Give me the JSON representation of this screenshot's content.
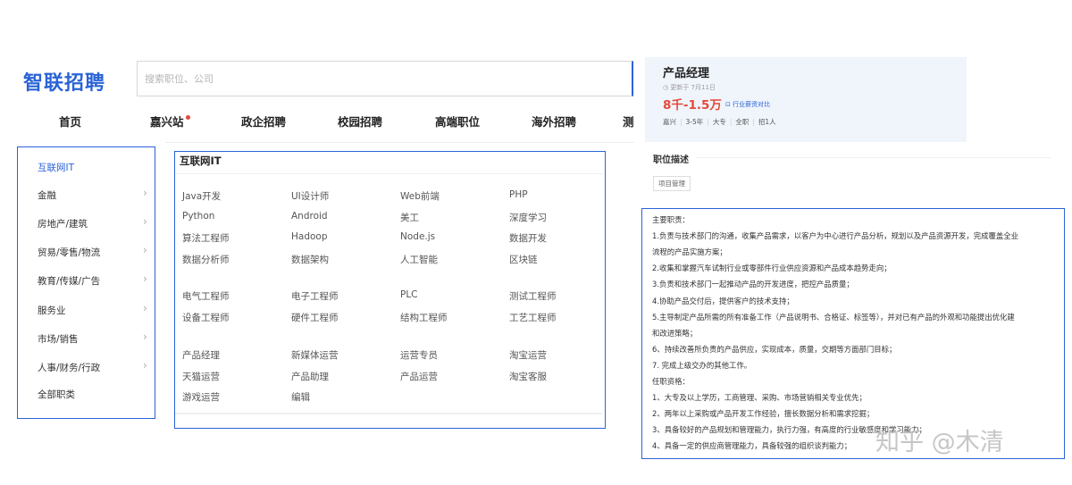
{
  "header": {
    "logo": "智联招聘",
    "search_placeholder": "搜索职位、公司"
  },
  "nav": [
    "首页",
    "嘉兴站",
    "政企招聘",
    "校园招聘",
    "高端职位",
    "海外招聘",
    "测"
  ],
  "categories": [
    {
      "label": "互联网IT",
      "chevron": ""
    },
    {
      "label": "金融",
      "chevron": "›"
    },
    {
      "label": "房地产/建筑",
      "chevron": "›"
    },
    {
      "label": "贸易/零售/物流",
      "chevron": "›"
    },
    {
      "label": "教育/传媒/广告",
      "chevron": "›"
    },
    {
      "label": "服务业",
      "chevron": "›"
    },
    {
      "label": "市场/销售",
      "chevron": "›"
    },
    {
      "label": "人事/财务/行政",
      "chevron": "›"
    },
    {
      "label": "全部职类",
      "chevron": ""
    }
  ],
  "jobs": {
    "title": "互联网IT",
    "groups": [
      [
        [
          "Java开发",
          "UI设计师",
          "Web前端",
          "PHP"
        ],
        [
          "Python",
          "Android",
          "美工",
          "深度学习"
        ],
        [
          "算法工程师",
          "Hadoop",
          "Node.js",
          "数据开发"
        ],
        [
          "数据分析师",
          "数据架构",
          "人工智能",
          "区块链"
        ]
      ],
      [
        [
          "电气工程师",
          "电子工程师",
          "PLC",
          "测试工程师"
        ],
        [
          "设备工程师",
          "硬件工程师",
          "结构工程师",
          "工艺工程师"
        ]
      ],
      [
        [
          "产品经理",
          "新媒体运营",
          "运营专员",
          "淘宝运营"
        ],
        [
          "天猫运营",
          "产品助理",
          "产品运营",
          "淘宝客服"
        ],
        [
          "游戏运营",
          "编辑",
          "",
          ""
        ]
      ]
    ]
  },
  "card": {
    "title": "产品经理",
    "update": "◷ 更新于 7月11日",
    "salary": "8千-1.5万",
    "compare": "⊡ 行业薪资对比",
    "tags": [
      "嘉兴",
      "3-5年",
      "大专",
      "全职",
      "招1人"
    ]
  },
  "jd": {
    "heading": "职位描述",
    "tag": "项目管理",
    "lines": [
      "主要职责：",
      "1.负责与技术部门的沟通，收集产品需求，以客户为中心进行产品分析，规划以及产品资源开发，完成覆盖全业",
      "流程的产品实施方案；",
      "2.收集和掌握汽车试制行业或零部件行业供应资源和产品成本趋势走向；",
      "3.负责和技术部门一起推动产品的开发进度，把控产品质量；",
      "4.协助产品交付后，提供客户的技术支持；",
      "5.主导制定产品所需的所有准备工作（产品说明书、合格证、标签等），并对已有产品的外观和功能提出优化建",
      "和改进策略；",
      "6、持续改善所负责的产品供应，实现成本，质量，交期等方面部门目标；",
      "7. 完成上级交办的其他工作。",
      "任职资格：",
      "1、大专及以上学历，工商管理、采购、市场营销相关专业优先；",
      "2、两年以上采购或产品开发工作经验，擅长数据分析和需求挖掘；",
      "3、具备较好的产品规划和管理能力，执行力强，有高度的行业敏感度和学习能力；",
      "4、具备一定的供应商管理能力，具备较强的组织谈判能力；"
    ]
  },
  "watermark": "知乎 @木清"
}
